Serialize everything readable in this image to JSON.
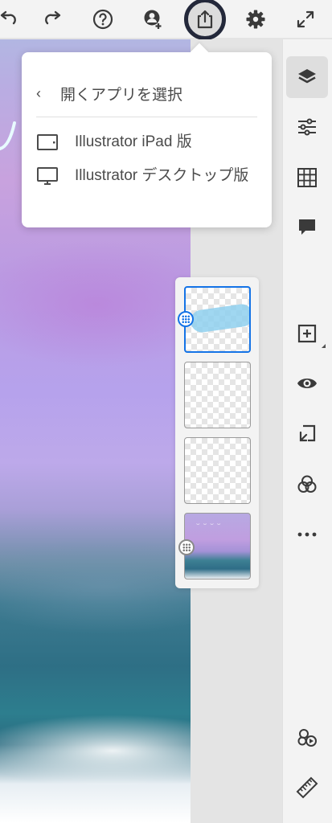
{
  "toolbar": {
    "buttons": [
      "undo",
      "redo",
      "help",
      "invite",
      "share",
      "settings",
      "fullscreen"
    ]
  },
  "share_menu": {
    "header": "開くアプリを選択",
    "items": [
      {
        "label": "Illustrator iPad 版",
        "icon": "tablet-icon"
      },
      {
        "label": "Illustrator デスクトップ版",
        "icon": "desktop-icon"
      }
    ]
  },
  "right_panel": {
    "tools": [
      "layers",
      "properties",
      "grid",
      "comments",
      "add-layer",
      "visibility",
      "import",
      "blend",
      "more",
      "livestream",
      "measure"
    ],
    "active": "layers"
  },
  "layers": {
    "count": 4,
    "selected_index": 0
  },
  "colors": {
    "accent": "#1473e6",
    "share_ring": "#23283a",
    "toolbar_bg": "#f3f3f3"
  }
}
